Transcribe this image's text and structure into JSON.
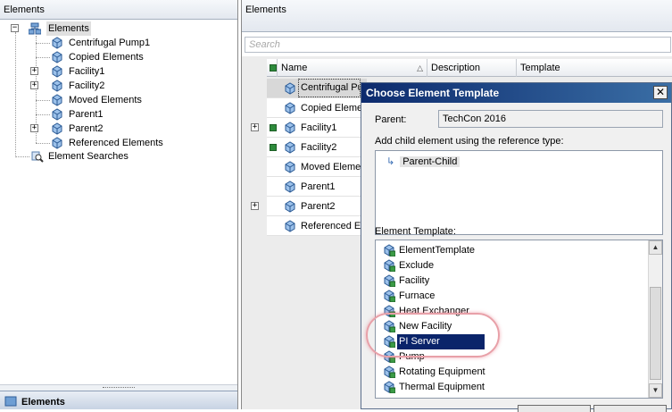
{
  "colors": {
    "title_bar_start": "#0c2a6d",
    "title_bar_end": "#3a6ea5",
    "selection": "#0a246a",
    "highlight_ring": "#e8a0a8"
  },
  "left_pane": {
    "header_title": "Elements",
    "tree": {
      "root": "Elements",
      "children": [
        "Centrifugal Pump1",
        "Copied Elements",
        "Facility1",
        "Facility2",
        "Moved Elements",
        "Parent1",
        "Parent2",
        "Referenced Elements"
      ],
      "expandable": [
        "Facility1",
        "Facility2",
        "Parent2"
      ],
      "searches": "Element Searches"
    },
    "bottom_tab": "Elements"
  },
  "right_pane": {
    "header_title": "Elements",
    "search_placeholder": "Search",
    "columns": {
      "name": "Name",
      "description": "Description",
      "template": "Template"
    },
    "rows": [
      {
        "name": "Centrifugal Pu",
        "expandable": false,
        "checked": false,
        "selected": true
      },
      {
        "name": "Copied Elemen",
        "expandable": false,
        "checked": false,
        "selected": false
      },
      {
        "name": "Facility1",
        "expandable": true,
        "checked": true,
        "selected": false
      },
      {
        "name": "Facility2",
        "expandable": false,
        "checked": true,
        "selected": false
      },
      {
        "name": "Moved Elemen",
        "expandable": false,
        "checked": false,
        "selected": false
      },
      {
        "name": "Parent1",
        "expandable": false,
        "checked": false,
        "selected": false
      },
      {
        "name": "Parent2",
        "expandable": true,
        "checked": false,
        "selected": false
      },
      {
        "name": "Referenced El",
        "expandable": false,
        "checked": false,
        "selected": false
      }
    ]
  },
  "dialog": {
    "title": "Choose Element Template",
    "close_glyph": "✕",
    "parent_label": "Parent:",
    "parent_value": "TechCon 2016",
    "reference_label": "Add child element using the reference type:",
    "reference_items": [
      "Parent-Child"
    ],
    "template_label": "Element Template:",
    "templates": [
      "ElementTemplate",
      "Exclude",
      "Facility",
      "Furnace",
      "Heat Exchanger",
      "New Facility",
      "PI Server",
      "Pump",
      "Rotating Equipment",
      "Thermal Equipment"
    ],
    "selected_template": "PI Server",
    "icons": {
      "template": "element-template-icon",
      "scroll_up": "▲",
      "scroll_down": "▼",
      "ref_arrow": "↳"
    }
  }
}
